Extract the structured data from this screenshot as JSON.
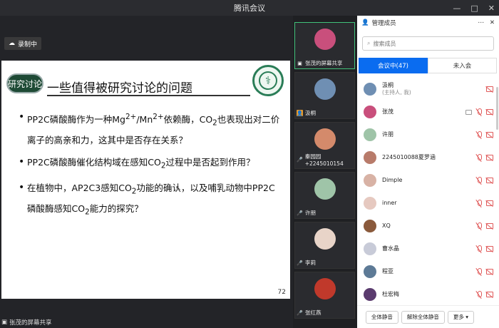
{
  "window": {
    "title": "腾讯会议",
    "min": "—",
    "max": "□",
    "close": "✕"
  },
  "main": {
    "recording_label": "录制中",
    "share_label": "张茂的屏幕共享",
    "slide": {
      "badge": "研究讨论",
      "title": "一些值得被研究讨论的问题",
      "page_number": "72",
      "bullets": [
        {
          "html": "PP2C磷酸酶作为一种Mg<sup>2+</sup>/Mn<sup>2+</sup>依赖酶，CO<sub>2</sub>也表现出对二价离子的高亲和力，这其中是否存在关系？"
        },
        {
          "html": "PP2C磷酸酶催化结构域在感知CO<sub>2</sub>过程中是否起到作用？"
        },
        {
          "html": "在植物中，AP2C3感知CO<sub>2</sub>功能的确认，以及哺乳动物中PP2C磷酸酶感知CO<sub>2</sub>能力的探究？"
        }
      ]
    }
  },
  "gallery": [
    {
      "name": "张茂的屏幕共享",
      "color": "#c94f7c",
      "active": true,
      "icon": "screen"
    },
    {
      "name": "汲桐",
      "color": "#6f8fb3",
      "icon": "host"
    },
    {
      "name": "秦园园+2245010154",
      "color": "#d48a6b",
      "icon": "mic"
    },
    {
      "name": "许朋",
      "color": "#9fc4a8",
      "icon": "mic"
    },
    {
      "name": "李莉",
      "color": "#e8d4c8",
      "icon": "mic"
    },
    {
      "name": "张红燕",
      "color": "#c0392b",
      "icon": "mic"
    }
  ],
  "panel": {
    "title": "管理成员",
    "more": "⋯",
    "search_placeholder": "搜索成员",
    "tabs": {
      "in_meeting": "会议中(47)",
      "not_joined": "未入会"
    },
    "members": [
      {
        "name": "汲桐",
        "role": "(主持人, 我)",
        "color": "#6f8fb3",
        "icons": [
          "cam"
        ]
      },
      {
        "name": "张茂",
        "color": "#c94f7c",
        "icons": [
          "screen",
          "mic",
          "cam"
        ]
      },
      {
        "name": "许朋",
        "color": "#9fc4a8",
        "icons": [
          "mic",
          "cam"
        ]
      },
      {
        "name": "2245010088夏罗涵",
        "color": "#b87b6a",
        "icons": [
          "mic",
          "cam"
        ]
      },
      {
        "name": "Dimple",
        "color": "#d8b2a5",
        "icons": [
          "mic",
          "cam"
        ]
      },
      {
        "name": "inner",
        "color": "#e6c9c0",
        "icons": [
          "mic",
          "cam"
        ]
      },
      {
        "name": "XQ",
        "color": "#8a5a3c",
        "icons": [
          "mic",
          "cam"
        ]
      },
      {
        "name": "曹水晶",
        "color": "#c8cbd8",
        "icons": [
          "mic",
          "cam"
        ]
      },
      {
        "name": "程亚",
        "color": "#5d7a96",
        "icons": [
          "mic",
          "cam"
        ]
      },
      {
        "name": "杜宏梅",
        "color": "#5a3b6e",
        "icons": [
          "mic",
          "cam"
        ]
      }
    ],
    "footer": {
      "mute_all": "全体静音",
      "unmute_all": "解除全体静音",
      "more": "更多 ▾"
    }
  },
  "colors": {
    "accent": "#0a6cf0",
    "active_border": "#41c27a",
    "muted": "#e05a5a"
  }
}
